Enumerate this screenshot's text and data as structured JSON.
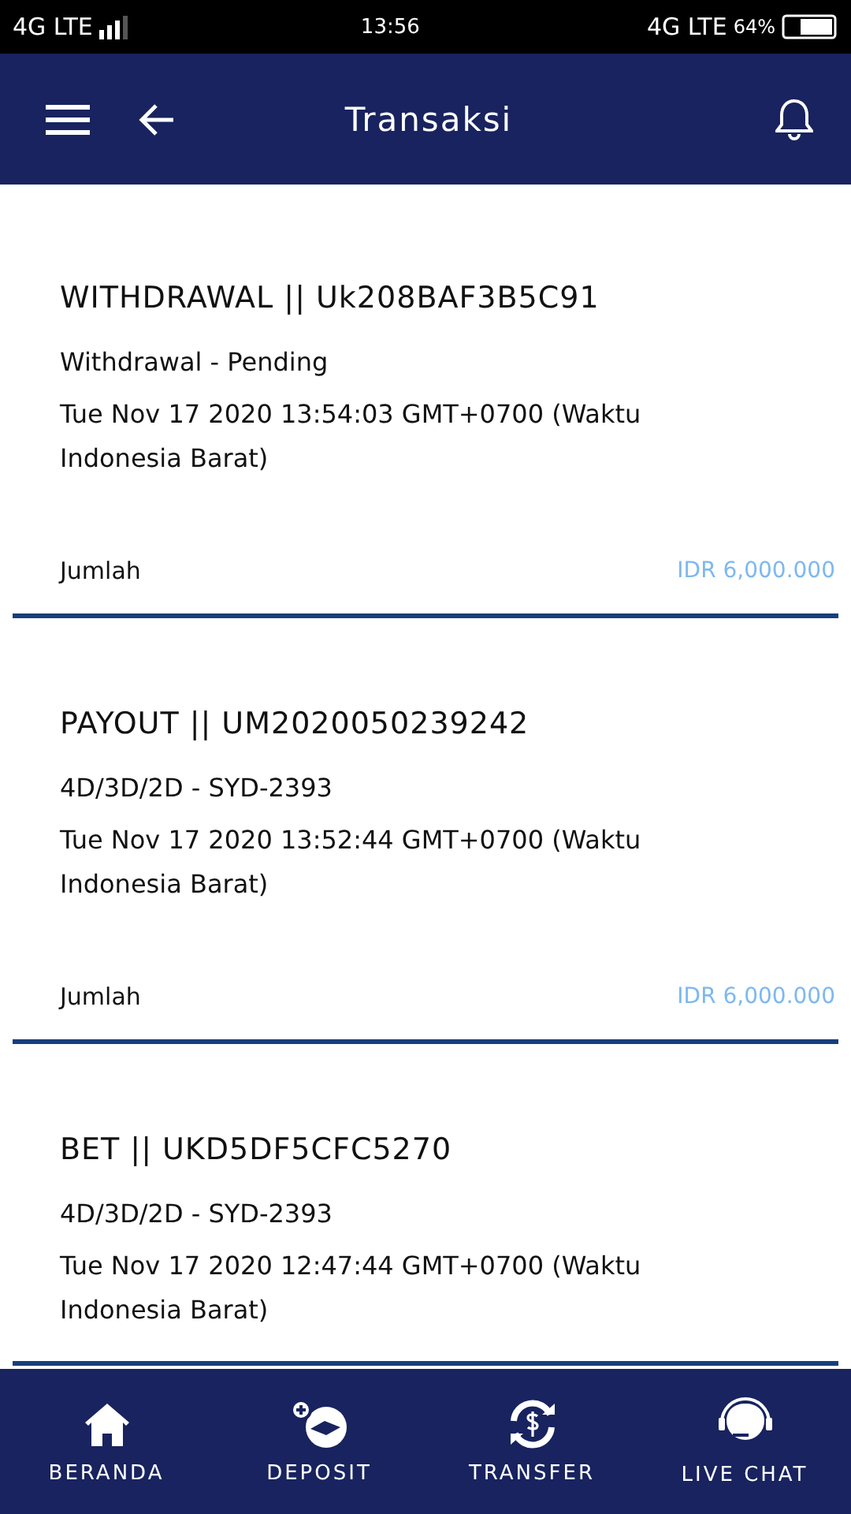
{
  "status_bar": {
    "network_left": "4G LTE",
    "time": "13:56",
    "network_right": "4G LTE",
    "battery": "64%"
  },
  "header": {
    "title": "Transaksi"
  },
  "transactions": [
    {
      "title": "WITHDRAWAL || Uk208BAF3B5C91",
      "subtitle": "Withdrawal - Pending",
      "date": "Tue Nov 17 2020 13:54:03 GMT+0700 (Waktu Indonesia Barat)",
      "amount_label": "Jumlah",
      "amount": "IDR 6,000.000"
    },
    {
      "title": "PAYOUT || UM2020050239242",
      "subtitle": "4D/3D/2D - SYD-2393",
      "date": "Tue Nov 17 2020 13:52:44 GMT+0700 (Waktu Indonesia Barat)",
      "amount_label": "Jumlah",
      "amount": "IDR 6,000.000"
    },
    {
      "title": "BET || UKD5DF5CFC5270",
      "subtitle": "4D/3D/2D - SYD-2393",
      "date": "Tue Nov 17 2020 12:47:44 GMT+0700 (Waktu Indonesia Barat)"
    }
  ],
  "bottom_nav": [
    {
      "kind": "home",
      "label": "BERANDA"
    },
    {
      "kind": "deposit",
      "label": "DEPOSIT"
    },
    {
      "kind": "transfer",
      "label": "TRANSFER"
    },
    {
      "kind": "chat",
      "label": "LIVE CHAT"
    }
  ]
}
